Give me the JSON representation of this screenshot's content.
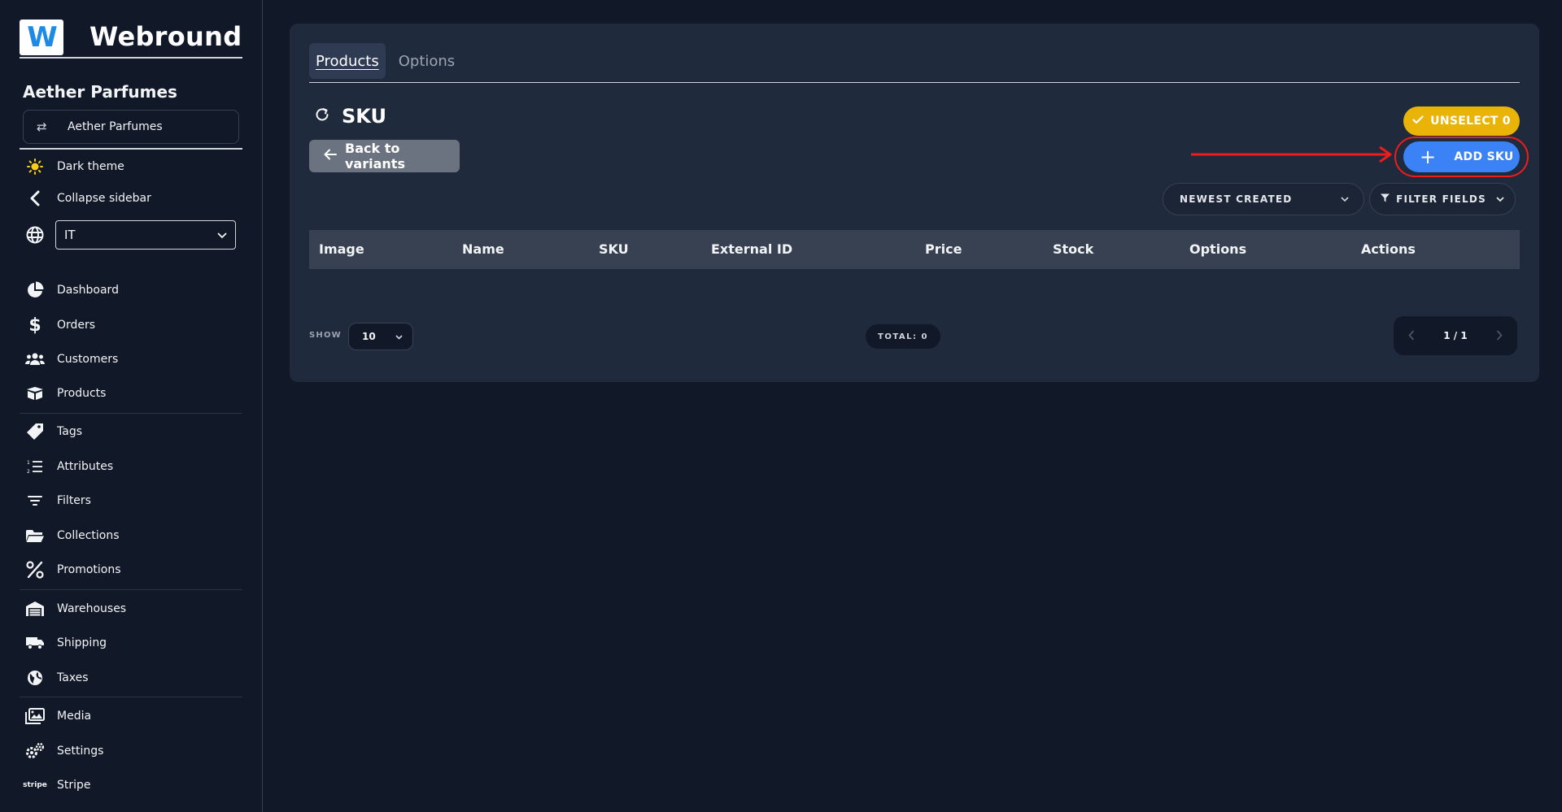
{
  "brand": {
    "name": "Webround",
    "logo_letter": "W"
  },
  "store": {
    "title": "Aether Parfumes",
    "switch_label": "Aether Parfumes"
  },
  "utilities": {
    "dark_theme": "Dark theme",
    "collapse_sidebar": "Collapse sidebar",
    "language": "IT"
  },
  "nav": {
    "dashboard": "Dashboard",
    "orders": "Orders",
    "customers": "Customers",
    "products": "Products",
    "tags": "Tags",
    "attributes": "Attributes",
    "filters": "Filters",
    "collections": "Collections",
    "promotions": "Promotions",
    "warehouses": "Warehouses",
    "shipping": "Shipping",
    "taxes": "Taxes",
    "media": "Media",
    "settings": "Settings",
    "stripe": "Stripe",
    "stripe_logo_text": "stripe"
  },
  "tabs": [
    "Products",
    "Options"
  ],
  "page": {
    "title": "SKU",
    "back_label": "Back to variants",
    "unselect_label": "UNSELECT 0",
    "add_label": "ADD SKU",
    "sort_label": "NEWEST CREATED",
    "filter_label": "FILTER FIELDS"
  },
  "table": {
    "columns": [
      "Image",
      "Name",
      "SKU",
      "External ID",
      "Price",
      "Stock",
      "Options",
      "Actions"
    ],
    "rows": []
  },
  "footer": {
    "show_label": "SHOW",
    "page_size": "10",
    "total_label": "TOTAL: 0",
    "page_indicator": "1 / 1"
  },
  "colors": {
    "accent_blue": "#3b82f6",
    "warning_yellow": "#eab308",
    "annotation_red": "#ef1c1c",
    "background": "#111827",
    "card": "#1f2a3c"
  }
}
